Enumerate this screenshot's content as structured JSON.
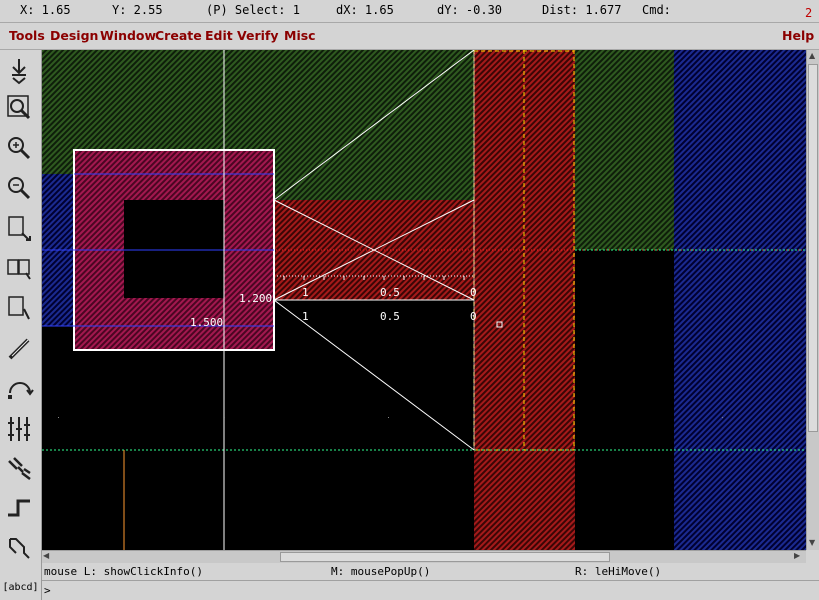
{
  "status": {
    "x": "X:  1.65",
    "y": "Y:  2.55",
    "select": "(P) Select: 1",
    "dx": "dX:  1.65",
    "dy": "dY: -0.30",
    "dist": "Dist: 1.677",
    "cmd": "Cmd:",
    "window_number": "2"
  },
  "menu": [
    "Tools",
    "Design",
    "Window",
    "Create",
    "Edit",
    "Verify",
    "Misc"
  ],
  "help": "Help",
  "toolbar": [
    "fit-view-icon",
    "zoom-area-icon",
    "zoom-in-icon",
    "zoom-out-icon",
    "stretch-icon",
    "copy-icon",
    "move-icon",
    "probe-icon",
    "rotate-icon",
    "ruler-icon",
    "split-icon",
    "path-icon",
    "polygon-icon"
  ],
  "canvas": {
    "ruler_labels": {
      "top_right": "1.200",
      "left_inner": "1.500",
      "upper_1": "1",
      "upper_05": "0.5",
      "upper_0": "0",
      "lower_1": "1",
      "lower_05": "0.5",
      "lower_0": "0"
    },
    "colors": {
      "green_hatch": "#2e5a1f",
      "blue_hatch": "#1a2a8a",
      "red_hatch": "#a01818",
      "pink_hatch": "#a0184e",
      "white_line": "#ffffff",
      "yellow_dash": "#ffd800"
    }
  },
  "mouse": {
    "left": "mouse L: showClickInfo()",
    "middle": "M: mousePopUp()",
    "right": "R: leHiMove()"
  },
  "prompt": ">",
  "abcd": "[abcd]"
}
